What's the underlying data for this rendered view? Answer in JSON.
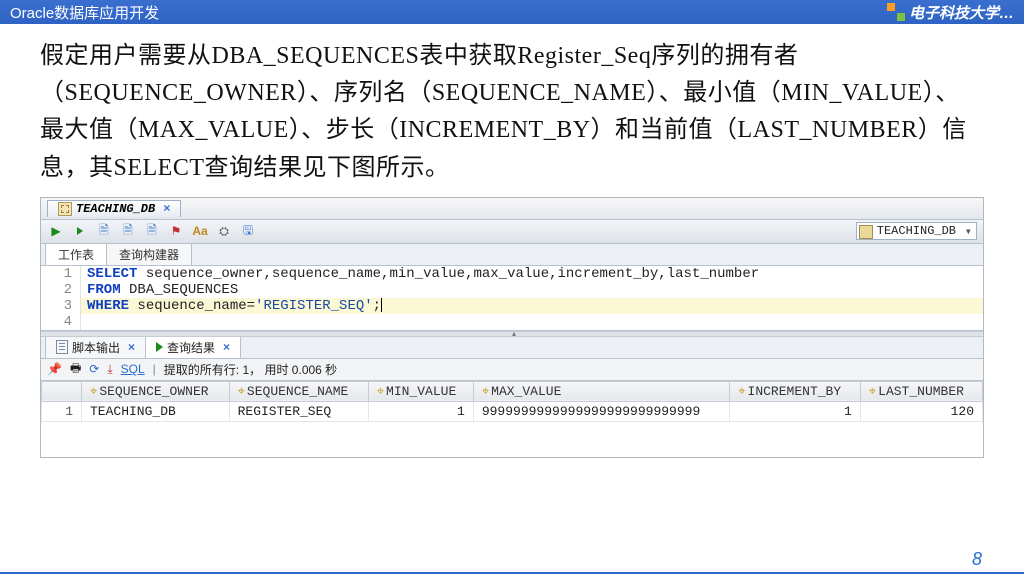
{
  "header": {
    "title": "Oracle数据库应用开发",
    "university": "电子科技大学…"
  },
  "bodytext": "假定用户需要从DBA_SEQUENCES表中获取Register_Seq序列的拥有者（SEQUENCE_OWNER）、序列名（SEQUENCE_NAME）、最小值（MIN_VALUE）、最大值（MAX_VALUE）、步长（INCREMENT_BY）和当前值（LAST_NUMBER）信息，其SELECT查询结果见下图所示。",
  "ide": {
    "tab_name": "TEACHING_DB",
    "connection": "TEACHING_DB",
    "subtabs": {
      "worksheet": "工作表",
      "builder": "查询构建器"
    },
    "sql_lines": [
      {
        "n": "1",
        "code_pre": "SELECT",
        "code_rest": " sequence_owner,sequence_name,min_value,max_value,increment_by,last_number"
      },
      {
        "n": "2",
        "code_pre": "FROM",
        "code_rest": " DBA_SEQUENCES"
      },
      {
        "n": "3",
        "code_pre": "WHERE",
        "code_rest_a": " sequence_name=",
        "code_str": "'REGISTER_SEQ'",
        "code_rest_b": ";"
      },
      {
        "n": "4",
        "code_pre": "",
        "code_rest": ""
      }
    ],
    "output_tabs": {
      "script": "脚本输出",
      "result": "查询结果"
    },
    "out_toolbar": {
      "sql_label": "SQL",
      "status": "提取的所有行: 1， 用时 0.006 秒"
    },
    "columns": [
      "SEQUENCE_OWNER",
      "SEQUENCE_NAME",
      "MIN_VALUE",
      "MAX_VALUE",
      "INCREMENT_BY",
      "LAST_NUMBER"
    ],
    "row": {
      "n": "1",
      "SEQUENCE_OWNER": "TEACHING_DB",
      "SEQUENCE_NAME": "REGISTER_SEQ",
      "MIN_VALUE": "1",
      "MAX_VALUE": "9999999999999999999999999999",
      "INCREMENT_BY": "1",
      "LAST_NUMBER": "120"
    }
  },
  "pagenum": "8"
}
